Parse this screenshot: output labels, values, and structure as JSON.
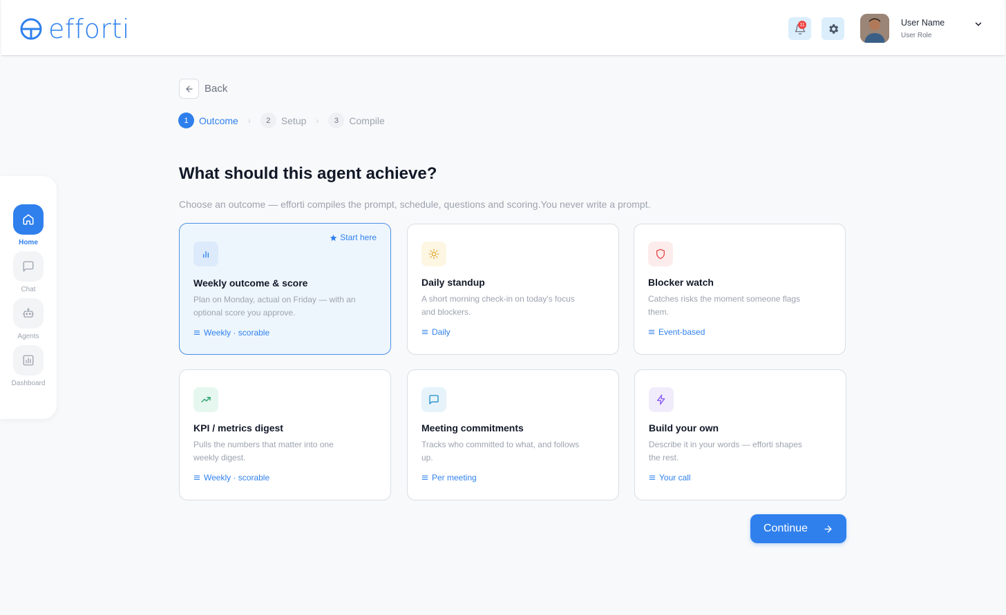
{
  "app": {
    "logo_text": "efforti"
  },
  "header": {
    "notification_count": "11",
    "user_name": "User Name",
    "user_role": "User Role"
  },
  "sidebar": {
    "items": [
      {
        "label": "Home",
        "icon": "home-icon",
        "active": true
      },
      {
        "label": "Chat",
        "icon": "chat-icon",
        "active": false
      },
      {
        "label": "Agents",
        "icon": "robot-icon",
        "active": false
      },
      {
        "label": "Dashboard",
        "icon": "dashboard-icon",
        "active": false
      }
    ]
  },
  "nav": {
    "back_label": "Back"
  },
  "steps": [
    {
      "number": "1",
      "label": "Outcome",
      "active": true
    },
    {
      "number": "2",
      "label": "Setup",
      "active": false
    },
    {
      "number": "3",
      "label": "Compile",
      "active": false
    }
  ],
  "main": {
    "title": "What should this agent achieve?",
    "subtitle": "Choose an outcome — efforti compiles the prompt, schedule, questions and scoring.You never write a prompt.",
    "start_here_label": "Start here",
    "continue_label": "Continue"
  },
  "cards": [
    {
      "title": "Weekly outcome & score",
      "description": "Plan on Monday, actual on Friday — with an optional score you approve.",
      "meta": "Weekly · scorable",
      "icon": "bar-chart-icon",
      "selected": true
    },
    {
      "title": "Daily standup",
      "description": "A short morning check-in on today's focus and blockers.",
      "meta": "Daily",
      "icon": "sun-icon",
      "selected": false
    },
    {
      "title": "Blocker watch",
      "description": "Catches risks the moment someone flags them.",
      "meta": "Event-based",
      "icon": "shield-icon",
      "selected": false
    },
    {
      "title": "KPI / metrics digest",
      "description": "Pulls the numbers that matter into one weekly digest.",
      "meta": "Weekly · scorable",
      "icon": "trending-up-icon",
      "selected": false
    },
    {
      "title": "Meeting commitments",
      "description": "Tracks who committed to what, and follows up.",
      "meta": "Per meeting",
      "icon": "message-icon",
      "selected": false
    },
    {
      "title": "Build your own",
      "description": "Describe it in your words — efforti shapes the rest.",
      "meta": "Your call",
      "icon": "lightning-icon",
      "selected": false
    }
  ],
  "colors": {
    "accent": "#2f80ed",
    "background": "#f8f9fa",
    "selected_card_bg": "#eef6fd",
    "icon_bg_blue": "#dceafb",
    "icon_bg_yellow": "#fdf6e3",
    "icon_bg_red": "#fdecec",
    "icon_bg_green": "#e6f7ef",
    "icon_bg_cyan": "#e6f3fb",
    "icon_bg_purple": "#f1ecfb"
  }
}
